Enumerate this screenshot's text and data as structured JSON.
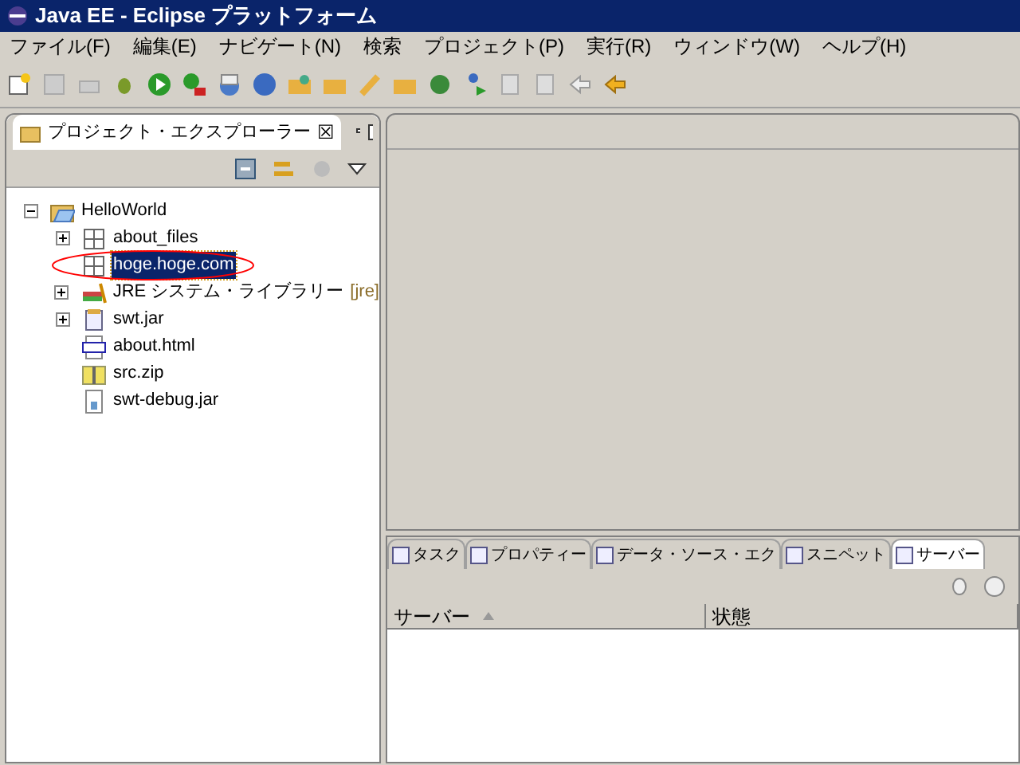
{
  "window": {
    "title": "Java EE - Eclipse プラットフォーム"
  },
  "menu": [
    "ファイル(F)",
    "編集(E)",
    "ナビゲート(N)",
    "検索",
    "プロジェクト(P)",
    "実行(R)",
    "ウィンドウ(W)",
    "ヘルプ(H)"
  ],
  "explorer": {
    "title": "プロジェクト・エクスプローラー",
    "close": "☒",
    "tree": [
      {
        "label": "HelloWorld",
        "kind": "project",
        "expanded": true,
        "selected": false,
        "children": [
          {
            "label": "about_files",
            "kind": "package",
            "expanded": false,
            "selected": false
          },
          {
            "label": "hoge.hoge.com",
            "kind": "package",
            "selected": true
          },
          {
            "label": "JRE システム・ライブラリー",
            "suffix": "[jre]",
            "kind": "library",
            "expanded": false,
            "selected": false
          },
          {
            "label": "swt.jar",
            "kind": "jar",
            "expanded": false,
            "selected": false
          },
          {
            "label": "about.html",
            "kind": "html",
            "selected": false
          },
          {
            "label": "src.zip",
            "kind": "zip",
            "selected": false
          },
          {
            "label": "swt-debug.jar",
            "kind": "file",
            "selected": false
          }
        ]
      }
    ]
  },
  "bottom_tabs": [
    {
      "label": "タスク",
      "selected": false
    },
    {
      "label": "プロパティー",
      "selected": false
    },
    {
      "label": "データ・ソース・エク",
      "selected": false
    },
    {
      "label": "スニペット",
      "selected": false
    },
    {
      "label": "サーバー",
      "selected": true
    }
  ],
  "table": {
    "columns": [
      {
        "label": "サーバー",
        "sorted": true
      },
      {
        "label": "状態",
        "sorted": false
      }
    ]
  }
}
